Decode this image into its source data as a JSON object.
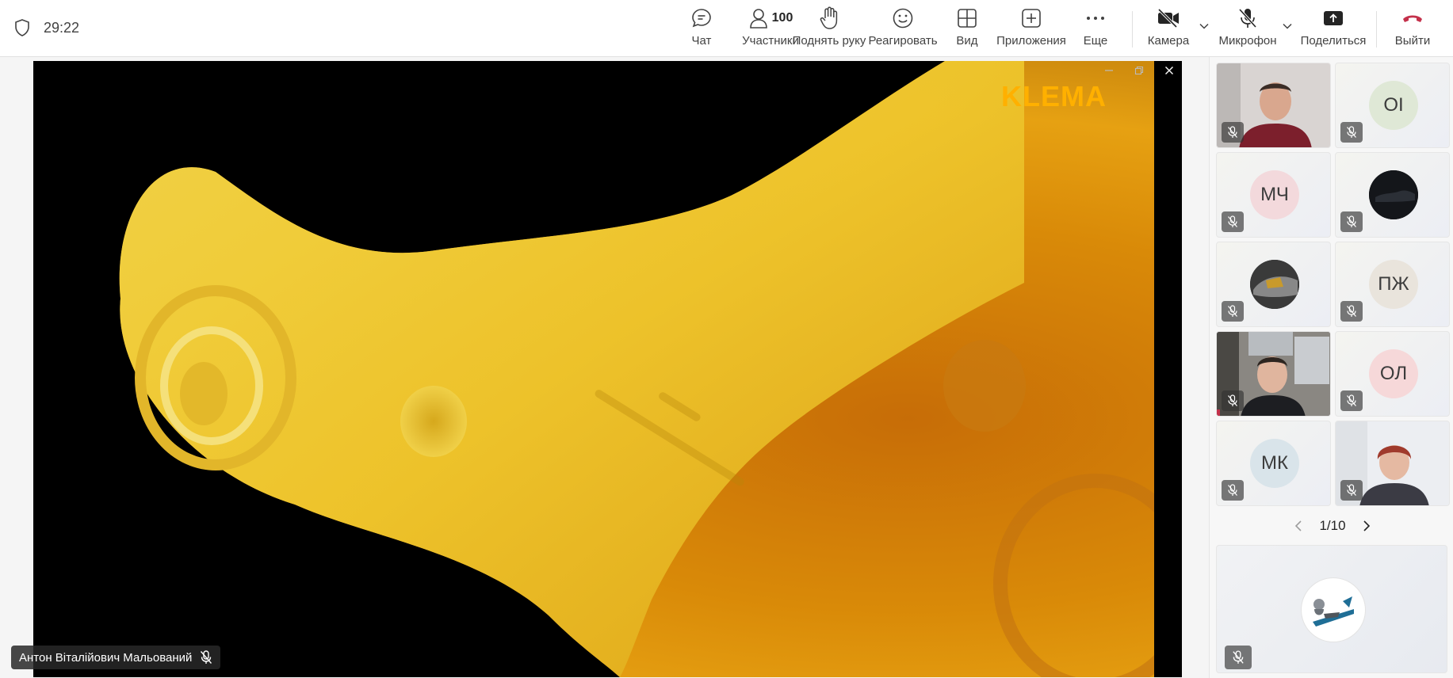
{
  "meeting": {
    "timer": "29:22"
  },
  "toolbar": {
    "chat_label": "Чат",
    "participants_label": "Участники",
    "participants_count": "100",
    "raise_hand_label": "Поднять руку",
    "react_label": "Реагировать",
    "view_label": "Вид",
    "apps_label": "Приложения",
    "more_label": "Еще",
    "camera_label": "Камера",
    "mic_label": "Микрофон",
    "share_label": "Поделиться",
    "leave_label": "Выйти",
    "leave_color": "#c4314b"
  },
  "stage": {
    "presenter_name": "Антон Віталійович Мальований",
    "watermark": "KLEMA"
  },
  "tiles": [
    {
      "type": "photo",
      "muted": true
    },
    {
      "type": "initials",
      "initials": "OI",
      "color": "#dfe8d6",
      "muted": true
    },
    {
      "type": "initials",
      "initials": "МЧ",
      "color": "#f3d9dc",
      "muted": true
    },
    {
      "type": "photo",
      "muted": true
    },
    {
      "type": "photo",
      "muted": true
    },
    {
      "type": "initials",
      "initials": "ПЖ",
      "color": "#e9e4dc",
      "muted": true
    },
    {
      "type": "photo",
      "muted": true
    },
    {
      "type": "initials",
      "initials": "ОЛ",
      "color": "#f6d8d9",
      "muted": true
    },
    {
      "type": "initials",
      "initials": "МК",
      "color": "#d9e4ea",
      "muted": true
    },
    {
      "type": "photo",
      "muted": true
    }
  ],
  "pager": {
    "text": "1/10"
  }
}
